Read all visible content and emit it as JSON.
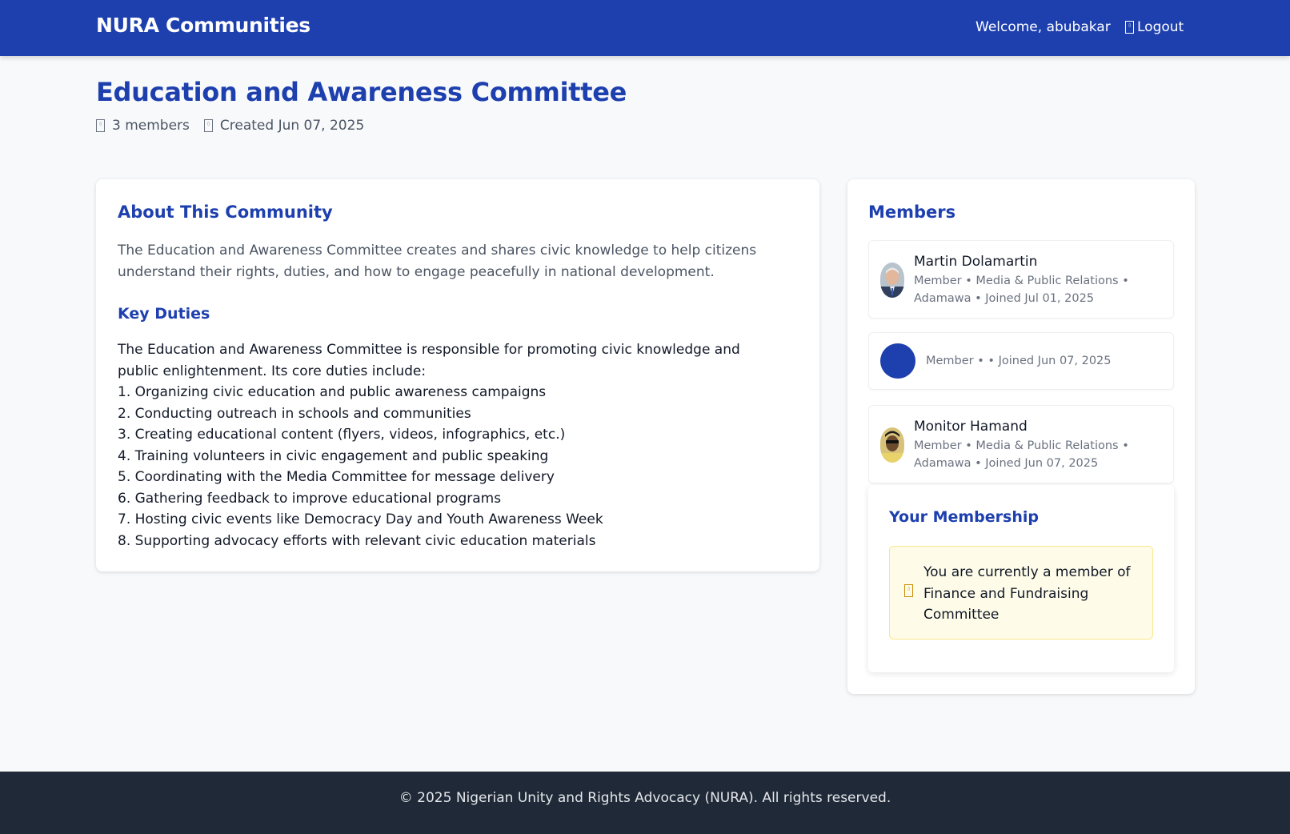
{
  "nav": {
    "brand": "NURA Communities",
    "welcome": "Welcome, abubakar",
    "logout_label": "Logout"
  },
  "community": {
    "title": "Education and Awareness Committee",
    "members_count": "3 members",
    "created": "Created Jun 07, 2025"
  },
  "about": {
    "heading": "About This Community",
    "description": "The Education and Awareness Committee creates and shares civic knowledge to help citizens understand their rights, duties, and how to engage peacefully in national development.",
    "duties_heading": "Key Duties",
    "duties_intro": "The Education and Awareness Committee is responsible for promoting civic knowledge and public enlightenment. Its core duties include:",
    "duties": [
      "1. Organizing civic education and public awareness campaigns",
      "2. Conducting outreach in schools and communities",
      "3. Creating educational content (flyers, videos, infographics, etc.)",
      "4. Training volunteers in civic engagement and public speaking",
      "5. Coordinating with the Media Committee for message delivery",
      "6. Gathering feedback to improve educational programs",
      "7. Hosting civic events like Democracy Day and Youth Awareness Week",
      "8. Supporting advocacy efforts with relevant civic education materials"
    ]
  },
  "members": {
    "heading": "Members",
    "list": [
      {
        "name": "Martin Dolamartin",
        "details": "Member • Media & Public Relations • Adamawa • Joined Jul 01, 2025"
      },
      {
        "name": "",
        "details": "Member • • Joined Jun 07, 2025"
      },
      {
        "name": "Monitor Hamand",
        "details": "Member • Media & Public Relations • Adamawa • Joined Jun 07, 2025"
      }
    ]
  },
  "membership": {
    "heading": "Your Membership",
    "notice": "You are currently a member of Finance and Fundraising Committee"
  },
  "footer": {
    "text": "© 2025 Nigerian Unity and Rights Advocacy (NURA). All rights reserved."
  },
  "colors": {
    "primary": "#1e40af",
    "footer_bg": "#1f2937",
    "notice_bg": "#fefce8",
    "notice_border": "#fde68a"
  }
}
